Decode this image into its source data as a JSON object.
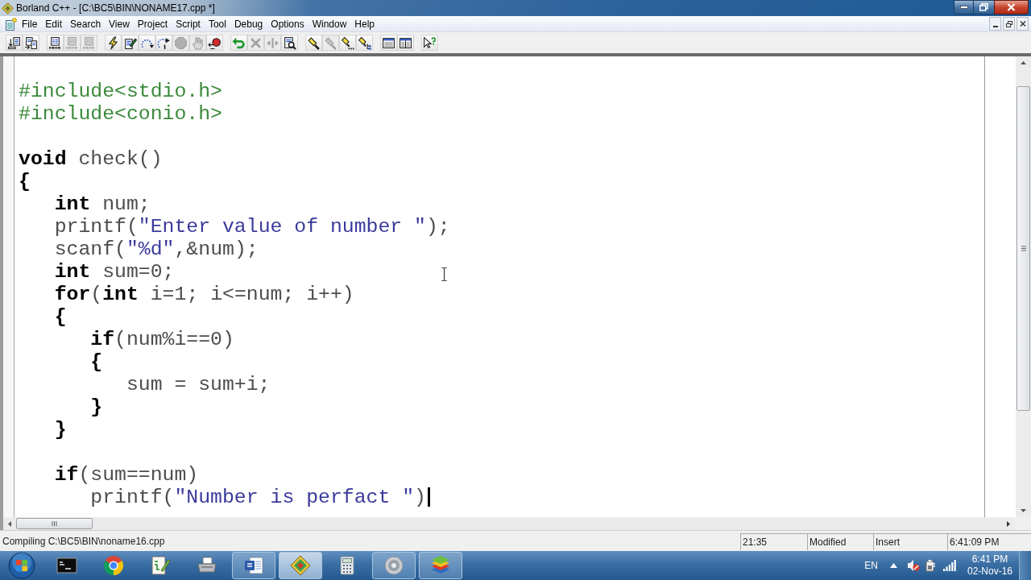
{
  "window": {
    "title": "Borland C++ - [C:\\BC5\\BIN\\NONAME17.cpp *]"
  },
  "menu": [
    "File",
    "Edit",
    "Search",
    "View",
    "Project",
    "Script",
    "Tool",
    "Debug",
    "Options",
    "Window",
    "Help"
  ],
  "toolbar": {
    "groups": [
      [
        {
          "disabled": false
        },
        {
          "disabled": false
        }
      ],
      [
        {
          "disabled": false
        },
        {
          "disabled": true
        },
        {
          "disabled": true
        }
      ],
      [
        {
          "disabled": false
        },
        {
          "disabled": false
        },
        {
          "disabled": false
        },
        {
          "disabled": false
        },
        {
          "disabled": true
        },
        {
          "disabled": true
        },
        {
          "disabled": false
        }
      ],
      [
        {
          "disabled": false
        },
        {
          "disabled": true
        },
        {
          "disabled": true
        },
        {
          "disabled": false
        }
      ],
      [
        {
          "disabled": false
        },
        {
          "disabled": true
        },
        {
          "disabled": false
        },
        {
          "disabled": false
        }
      ],
      [
        {
          "disabled": false
        },
        {
          "disabled": false
        }
      ],
      [
        {
          "disabled": false
        }
      ]
    ]
  },
  "editor": {
    "blocks": [
      [
        {
          "tokens": [
            {
              "kind": "preprocessor",
              "text": "#include<stdio.h>"
            }
          ],
          "caret": false
        },
        {
          "tokens": [
            {
              "kind": "preprocessor",
              "text": "#include<conio.h>"
            }
          ],
          "caret": false
        }
      ],
      [
        {
          "tokens": [
            {
              "kind": "keyword",
              "text": "void"
            },
            {
              "kind": "plain",
              "text": " check()"
            }
          ],
          "caret": false
        },
        {
          "tokens": [
            {
              "kind": "brace",
              "text": "{"
            }
          ],
          "caret": false
        },
        {
          "tokens": [
            {
              "kind": "keyword",
              "text": "   int"
            },
            {
              "kind": "plain",
              "text": " num;"
            }
          ],
          "caret": false
        },
        {
          "tokens": [
            {
              "kind": "plain",
              "text": "   printf("
            },
            {
              "kind": "string",
              "text": "\"Enter value of number \""
            },
            {
              "kind": "plain",
              "text": ");"
            }
          ],
          "caret": false
        },
        {
          "tokens": [
            {
              "kind": "plain",
              "text": "   scanf("
            },
            {
              "kind": "string",
              "text": "\"%d\""
            },
            {
              "kind": "plain",
              "text": ",&num);"
            }
          ],
          "caret": false
        },
        {
          "tokens": [
            {
              "kind": "keyword",
              "text": "   int"
            },
            {
              "kind": "plain",
              "text": " sum=0;"
            }
          ],
          "caret": false
        },
        {
          "tokens": [
            {
              "kind": "keyword",
              "text": "   for"
            },
            {
              "kind": "plain",
              "text": "("
            },
            {
              "kind": "keyword",
              "text": "int"
            },
            {
              "kind": "plain",
              "text": " i=1; i<=num; i++)"
            }
          ],
          "caret": false
        },
        {
          "tokens": [
            {
              "kind": "brace",
              "text": "   {"
            }
          ],
          "caret": false
        },
        {
          "tokens": [
            {
              "kind": "keyword",
              "text": "      if"
            },
            {
              "kind": "plain",
              "text": "(num%i==0)"
            }
          ],
          "caret": false
        },
        {
          "tokens": [
            {
              "kind": "brace",
              "text": "      {"
            }
          ],
          "caret": false
        },
        {
          "tokens": [
            {
              "kind": "plain",
              "text": "         sum = sum+i;"
            }
          ],
          "caret": false
        },
        {
          "tokens": [
            {
              "kind": "brace",
              "text": "      }"
            }
          ],
          "caret": false
        },
        {
          "tokens": [
            {
              "kind": "brace",
              "text": "   }"
            }
          ],
          "caret": false
        }
      ],
      [
        {
          "tokens": [
            {
              "kind": "keyword",
              "text": "   if"
            },
            {
              "kind": "plain",
              "text": "(sum==num)"
            }
          ],
          "caret": false
        },
        {
          "tokens": [
            {
              "kind": "plain",
              "text": "      printf("
            },
            {
              "kind": "string",
              "text": "\"Number is perfact \""
            },
            {
              "kind": "plain",
              "text": ")"
            }
          ],
          "caret": true
        }
      ]
    ]
  },
  "status_bar": {
    "message": "Compiling C:\\BC5\\BIN\\noname16.cpp",
    "panels": [
      "21:35",
      "Modified",
      "Insert",
      "6:41:09 PM"
    ]
  },
  "taskbar": {
    "apps": [
      {
        "running": false,
        "selected": false
      },
      {
        "running": false,
        "selected": false
      },
      {
        "running": false,
        "selected": false
      },
      {
        "running": false,
        "selected": false
      },
      {
        "running": true,
        "selected": false
      },
      {
        "running": true,
        "selected": true
      },
      {
        "running": false,
        "selected": false
      },
      {
        "running": true,
        "selected": false
      },
      {
        "running": true,
        "selected": false
      }
    ],
    "tray": {
      "language": "EN",
      "time": "6:41 PM",
      "date": "02-Nov-16"
    }
  }
}
